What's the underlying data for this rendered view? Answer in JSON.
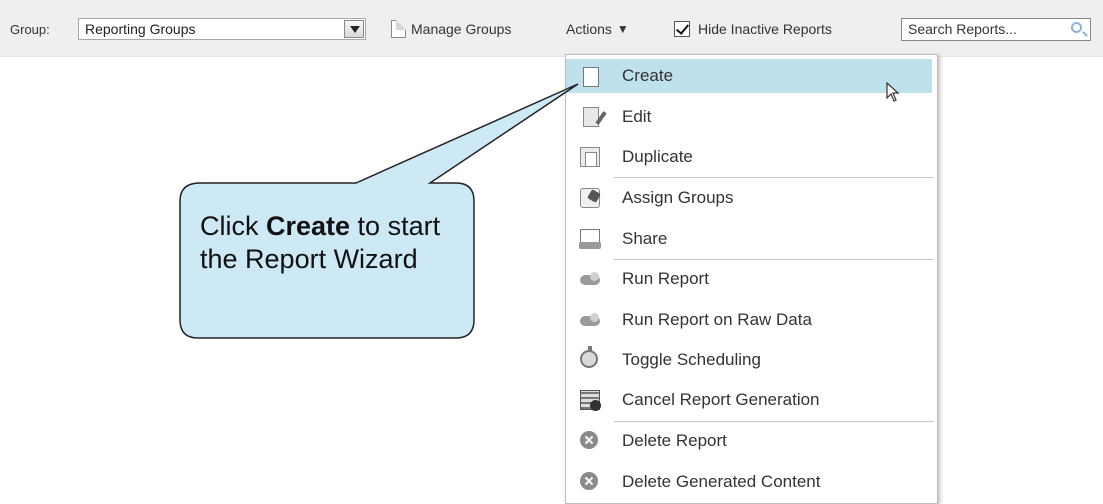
{
  "toolbar": {
    "group_label": "Group:",
    "group_value": "Reporting Groups",
    "manage_groups": "Manage Groups",
    "actions": "Actions",
    "actions_caret": "▼",
    "hide_inactive": "Hide Inactive Reports",
    "hide_inactive_checked": true,
    "search_placeholder": "Search Reports..."
  },
  "menu": {
    "items": [
      {
        "label": "Create",
        "icon": "page-icon",
        "highlighted": true
      },
      {
        "label": "Edit",
        "icon": "edit-icon"
      },
      {
        "label": "Duplicate",
        "icon": "duplicate-icon"
      },
      {
        "label": "Assign Groups",
        "icon": "assign-groups-icon"
      },
      {
        "label": "Share",
        "icon": "share-icon"
      },
      {
        "label": "Run Report",
        "icon": "run-report-icon"
      },
      {
        "label": "Run Report on Raw Data",
        "icon": "run-raw-icon"
      },
      {
        "label": "Toggle Scheduling",
        "icon": "stopwatch-icon"
      },
      {
        "label": "Cancel Report Generation",
        "icon": "cancel-generation-icon"
      },
      {
        "label": "Delete Report",
        "icon": "delete-icon"
      },
      {
        "label": "Delete Generated Content",
        "icon": "delete-icon"
      }
    ]
  },
  "callout": {
    "prefix": "Click ",
    "bold": "Create",
    "suffix": " to start the Report Wizard"
  },
  "colors": {
    "toolbar_bg": "#efefef",
    "highlight": "#bfe1ee",
    "callout_fill": "#cde9f5"
  }
}
